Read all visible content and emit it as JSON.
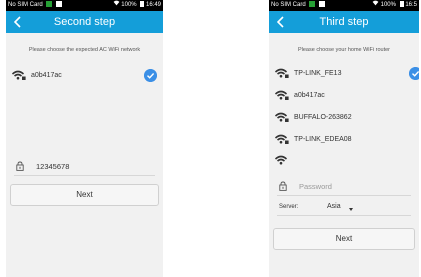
{
  "status_bar": {
    "carrier": "No SIM Card",
    "battery_left": "100%",
    "time_left": "16:49",
    "battery_right": "100%",
    "time_right": "16:5"
  },
  "screen_second": {
    "title": "Second step",
    "instruction": "Please choose the expected AC WiFi network",
    "networks": [
      {
        "name": "a0b417ac",
        "selected": true
      }
    ],
    "password_value": "12345678",
    "next_label": "Next"
  },
  "screen_third": {
    "title": "Third step",
    "instruction": "Please choose your home WiFi router",
    "networks": [
      {
        "name": "TP-LINK_FE13",
        "selected": true
      },
      {
        "name": "a0b417ac",
        "selected": false
      },
      {
        "name": "BUFFALO-263862",
        "selected": false
      },
      {
        "name": "TP-LINK_EDEA08",
        "selected": false
      },
      {
        "name": "",
        "selected": false
      }
    ],
    "password_placeholder": "Password",
    "server_label": "Server:",
    "server_value": "Asia",
    "next_label": "Next"
  },
  "colors": {
    "accent": "#149ed9",
    "check": "#3b8fe6",
    "background": "#f1f1f1"
  }
}
